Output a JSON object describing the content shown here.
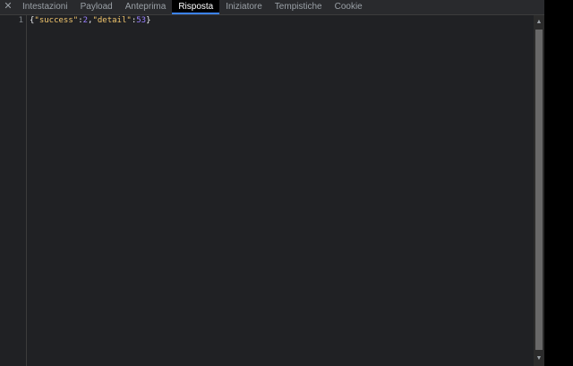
{
  "tabs": {
    "close_symbol": "✕",
    "items": [
      {
        "label": "Intestazioni",
        "active": false
      },
      {
        "label": "Payload",
        "active": false
      },
      {
        "label": "Anteprima",
        "active": false
      },
      {
        "label": "Risposta",
        "active": true
      },
      {
        "label": "Iniziatore",
        "active": false
      },
      {
        "label": "Tempistiche",
        "active": false
      },
      {
        "label": "Cookie",
        "active": false
      }
    ]
  },
  "editor": {
    "line_number": "1",
    "code": {
      "open_brace": "{",
      "key1": "\"success\"",
      "colon1": ":",
      "value1": "2",
      "comma": ",",
      "key2": "\"detail\"",
      "colon2": ":",
      "value2": "53",
      "close_brace": "}"
    }
  },
  "scrollbar": {
    "up_arrow": "▲",
    "down_arrow": "▼"
  },
  "colors": {
    "background": "#202124",
    "active_tab_background": "#000000",
    "json_key": "#f2c66d",
    "json_number": "#9980ff"
  }
}
